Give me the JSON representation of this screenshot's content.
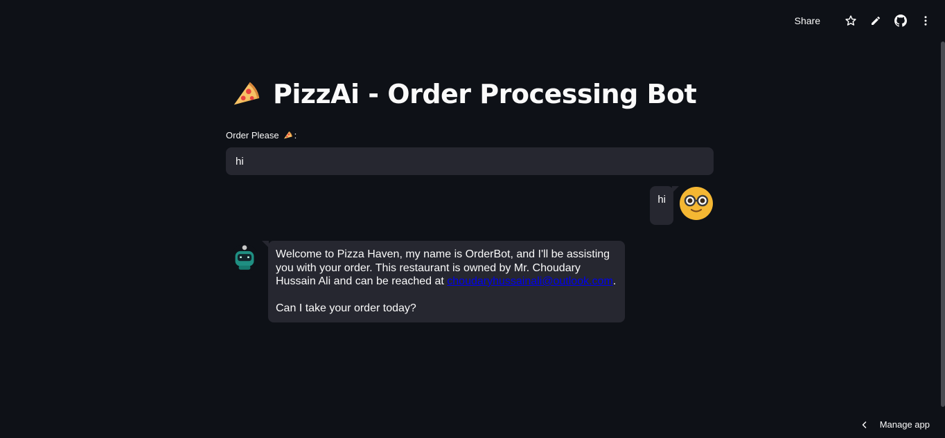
{
  "toolbar": {
    "share_label": "Share",
    "icons": [
      "star-icon",
      "pencil-icon",
      "github-icon",
      "more-vertical-icon"
    ]
  },
  "header": {
    "title": "PizzAi - Order Processing Bot",
    "title_icon": "pizza-icon"
  },
  "order_input": {
    "label": "Order Please",
    "label_suffix": ":",
    "value": "hi"
  },
  "chat": {
    "messages": [
      {
        "role": "user",
        "avatar": "nerd-face-avatar",
        "text": "hi"
      },
      {
        "role": "assistant",
        "avatar": "robot-avatar",
        "text_before_link": "Welcome to Pizza Haven, my name is OrderBot, and I'll be assisting you with your order. This restaurant is owned by Mr. Choudary Hussain Ali and can be reached at ",
        "link_text": "choudaryhussainali@outlook.com",
        "text_after_link": ".",
        "followup": "Can I take your order today?"
      }
    ]
  },
  "footer": {
    "manage_label": "Manage app"
  },
  "colors": {
    "background": "#0e1117",
    "surface": "#262730",
    "text": "#fafafa",
    "link": "#0000ee",
    "avatar_yellow": "#f4b733"
  }
}
